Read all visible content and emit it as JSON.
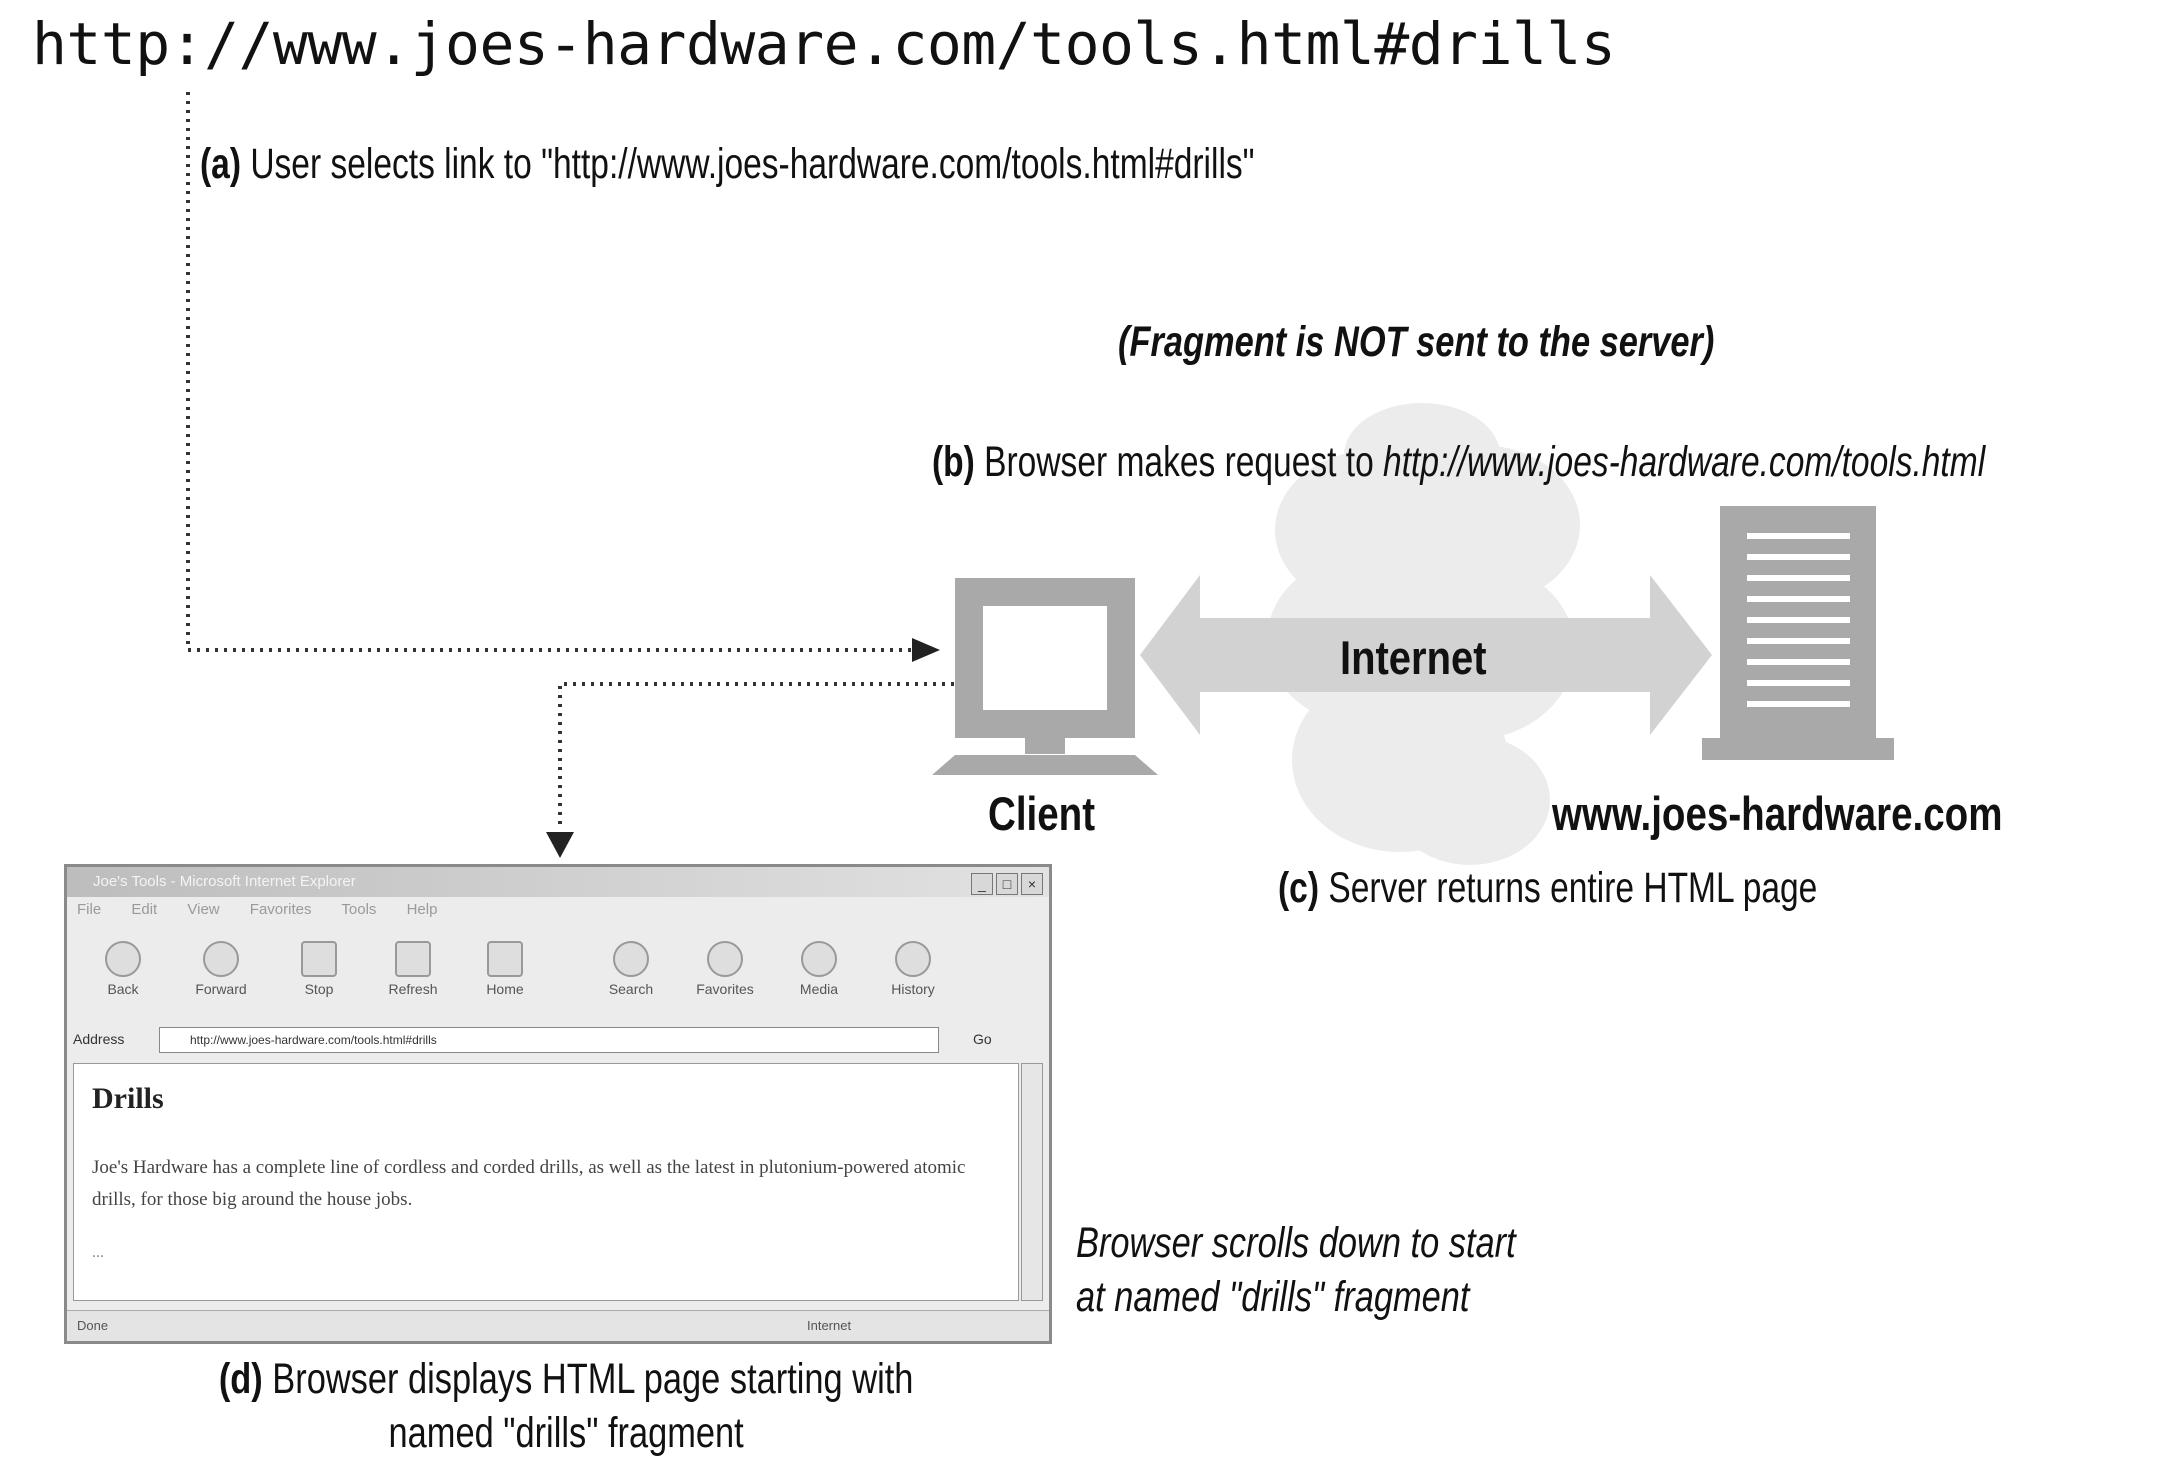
{
  "url": "http://www.joes-hardware.com/tools.html#drills",
  "step_a": {
    "letter": "(a)",
    "text": " User selects link to \"http://www.joes-hardware.com/tools.html#drills\""
  },
  "fragment_note": "(Fragment is NOT sent to the server)",
  "step_b": {
    "letter": "(b)",
    "text": " Browser makes request to ",
    "url": "http://www.joes-hardware.com/tools.html"
  },
  "labels": {
    "internet": "Internet",
    "client": "Client",
    "server": "www.joes-hardware.com"
  },
  "step_c": {
    "letter": "(c)",
    "text": " Server returns entire HTML page"
  },
  "scroll_note": {
    "line1": "Browser scrolls down to start",
    "line2": "at named \"drills\" fragment"
  },
  "step_d": {
    "letter": "(d)",
    "line1": " Browser displays HTML page starting with",
    "line2": "named \"drills\" fragment"
  },
  "browser": {
    "title": "Joe's Tools - Microsoft Internet Explorer",
    "menu": [
      "File",
      "Edit",
      "View",
      "Favorites",
      "Tools",
      "Help"
    ],
    "toolbar": [
      "Back",
      "Forward",
      "Stop",
      "Refresh",
      "Home",
      "Search",
      "Favorites",
      "Media",
      "History"
    ],
    "address_label": "Address",
    "address_value": "http://www.joes-hardware.com/tools.html#drills",
    "go_label": "Go",
    "heading": "Drills",
    "paragraph": "Joe's Hardware has a complete line of cordless and corded drills, as well as the latest in plutonium-powered atomic drills, for those big around the house jobs.",
    "ellipsis": "...",
    "status_left": "Done",
    "status_right": "Internet"
  },
  "colors": {
    "arrow_gray": "#d2d2d2",
    "cloud_gray": "#ececec",
    "device_gray": "#a9a9a9"
  }
}
